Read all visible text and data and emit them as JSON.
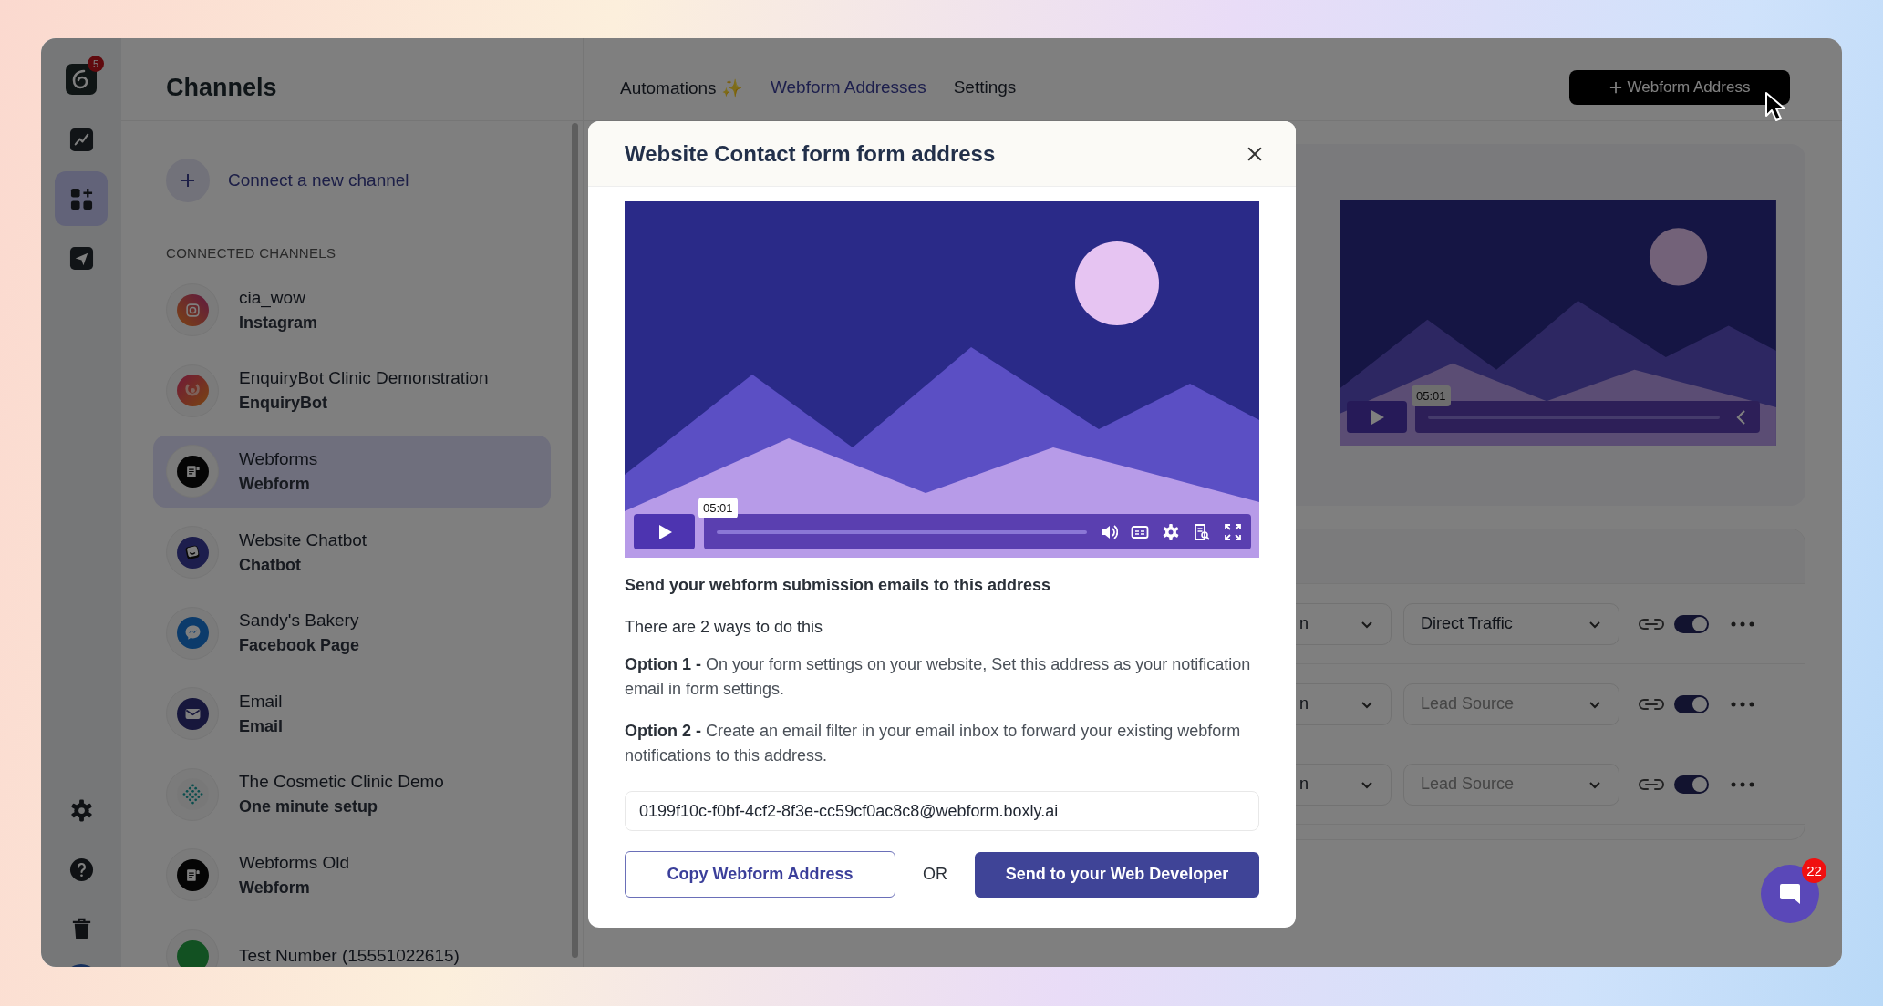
{
  "rail": {
    "logo": {
      "badge": "5"
    },
    "items": [
      {
        "kind": "analytics",
        "selected": false
      },
      {
        "kind": "channels",
        "selected": true
      },
      {
        "kind": "send",
        "selected": false
      }
    ],
    "bottom_items": [
      {
        "kind": "settings"
      },
      {
        "kind": "help"
      },
      {
        "kind": "trash"
      },
      {
        "kind": "avatar"
      }
    ]
  },
  "channels_panel": {
    "title": "Channels",
    "connect_label": "Connect a new channel",
    "section_label": "CONNECTED CHANNELS",
    "items": [
      {
        "name": "cia_wow",
        "type": "Instagram",
        "kind": "instagram",
        "selected": false
      },
      {
        "name": "EnquiryBot Clinic Demonstration",
        "type": "EnquiryBot",
        "kind": "enquirybot",
        "selected": false
      },
      {
        "name": "Webforms",
        "type": "Webform",
        "kind": "webform",
        "selected": true
      },
      {
        "name": "Website Chatbot",
        "type": "Chatbot",
        "kind": "chatbot",
        "selected": false
      },
      {
        "name": "Sandy's Bakery",
        "type": "Facebook Page",
        "kind": "messenger",
        "selected": false
      },
      {
        "name": "Email",
        "type": "Email",
        "kind": "email",
        "selected": false
      },
      {
        "name": "The Cosmetic Clinic Demo",
        "type": "One minute setup",
        "kind": "cosmetic",
        "selected": false
      },
      {
        "name": "Webforms Old",
        "type": "Webform",
        "kind": "webform",
        "selected": false
      },
      {
        "name": "Test Number (15551022615)",
        "kind": "phone",
        "selected": false
      }
    ]
  },
  "tabs": [
    {
      "label": "Automations ✨",
      "selected": false
    },
    {
      "label": "Webform Addresses",
      "selected": true
    },
    {
      "label": "Settings",
      "selected": false
    }
  ],
  "add_button": {
    "label": "Webform Address"
  },
  "preview_card": {
    "kind": "picture",
    "time": "05:01"
  },
  "table": {
    "rows": [
      {
        "column_1": "n",
        "value": "Direct Traffic",
        "on": true
      },
      {
        "column_1": "n",
        "placeholder": "Lead Source",
        "on": true
      },
      {
        "column_1": "n",
        "placeholder": "Lead Source",
        "on": true
      }
    ]
  },
  "chat": {
    "badge": "22"
  },
  "modal": {
    "title": "Website Contact form form address",
    "video": {
      "kind": "picture",
      "time": "05:01"
    },
    "heading": "Send your webform submission emails to this address",
    "intro": "There are 2 ways to do this",
    "options": [
      "**Option 1 -** On your form settings on your website, Set this address as your notification email in form settings.",
      "**Option 2 -** Create an email filter in your email inbox to forward your existing webform notifications to this address."
    ],
    "address": "0199f10c-f0bf-4cf2-8f3e-cc59cf0ac8c8@webform.boxly.ai",
    "copy_button": "Copy Webform Address",
    "or_label": "OR",
    "send_button": "Send to your Web Developer"
  }
}
